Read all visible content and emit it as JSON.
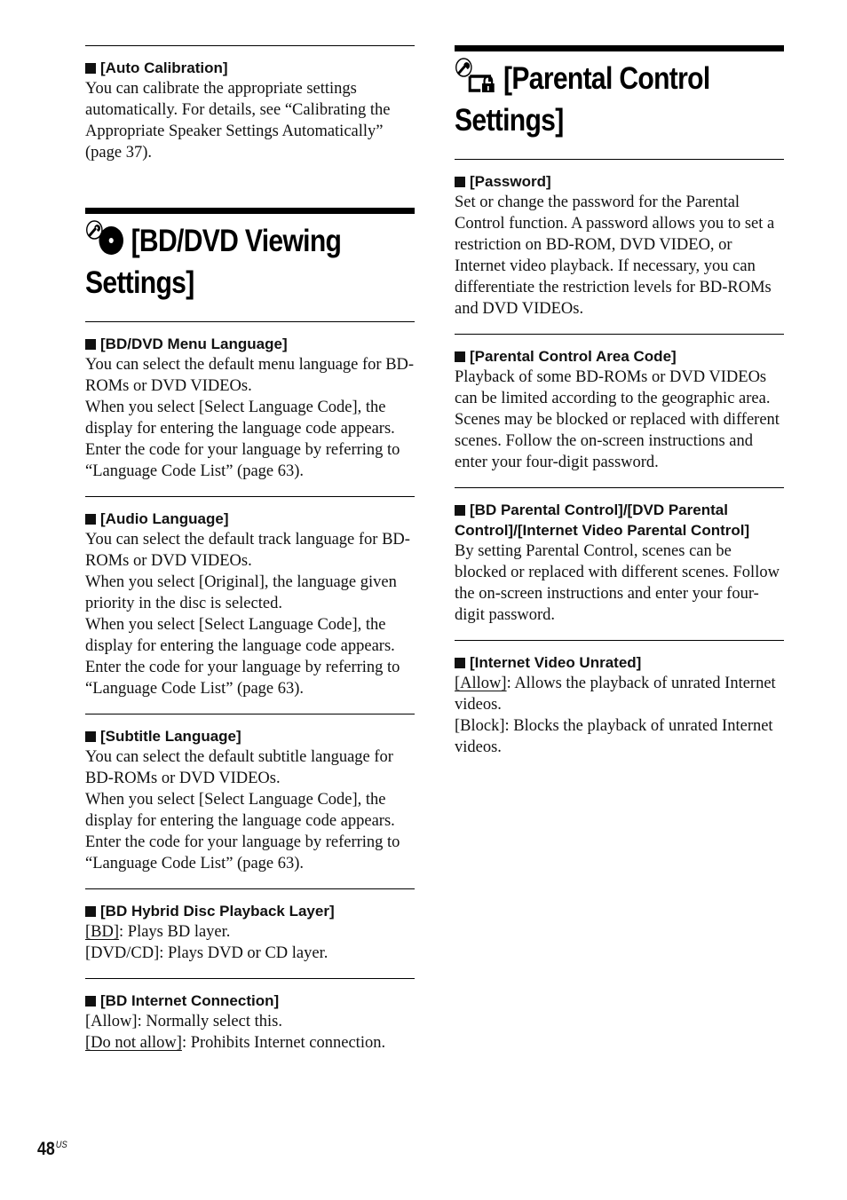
{
  "left_column": {
    "auto_calibration": {
      "heading": "[Auto Calibration]",
      "lines": [
        "You can calibrate the appropriate settings automatically. For details, see “Calibrating the Appropriate Speaker Settings Automatically” (page 37)."
      ]
    },
    "bd_dvd_chapter": {
      "icon": "wrench-disc-icon",
      "title": "[BD/DVD Viewing Settings]"
    },
    "menu_language": {
      "heading": "[BD/DVD Menu Language]",
      "lines": [
        "You can select the default menu language for BD-ROMs or DVD VIDEOs.",
        "When you select [Select Language Code], the display for entering the language code appears. Enter the code for your language by referring to “Language Code List” (page 63)."
      ]
    },
    "audio_language": {
      "heading": "[Audio Language]",
      "lines": [
        "You can select the default track language for BD-ROMs or DVD VIDEOs.",
        "When you select [Original], the language given priority in the disc is selected.",
        "When you select [Select Language Code], the display for entering the language code appears. Enter the code for your language by referring to “Language Code List” (page 63)."
      ]
    },
    "subtitle_language": {
      "heading": "[Subtitle Language]",
      "lines": [
        "You can select the default subtitle language for BD-ROMs or DVD VIDEOs.",
        "When you select [Select Language Code], the display for entering the language code appears. Enter the code for your language by referring to “Language Code List” (page 63)."
      ]
    },
    "hybrid_disc": {
      "heading": "[BD Hybrid Disc Playback Layer]",
      "options": [
        {
          "label": "[BD]",
          "default": true,
          "desc": ": Plays BD layer."
        },
        {
          "label": "[DVD/CD]",
          "default": false,
          "desc": ": Plays DVD or CD layer."
        }
      ]
    },
    "internet_connection": {
      "heading": "[BD Internet Connection]",
      "options": [
        {
          "label": "[Allow]",
          "default": false,
          "desc": ": Normally select this."
        },
        {
          "label": "[Do not allow]",
          "default": true,
          "desc": ": Prohibits Internet connection."
        }
      ]
    }
  },
  "right_column": {
    "parental_chapter": {
      "icon": "wrench-lock-icon",
      "title": "[Parental Control Settings]"
    },
    "password": {
      "heading": "[Password]",
      "lines": [
        "Set or change the password for the Parental Control function. A password allows you to set a restriction on BD-ROM, DVD VIDEO, or Internet video playback. If necessary, you can differentiate the restriction levels for BD-ROMs and DVD VIDEOs."
      ]
    },
    "area_code": {
      "heading": "[Parental Control Area Code]",
      "lines": [
        "Playback of some BD-ROMs or DVD VIDEOs can be limited according to the geographic area. Scenes may be blocked or replaced with different scenes. Follow the on-screen instructions and enter your four-digit password."
      ]
    },
    "parental_controls": {
      "heading": "[BD Parental Control]/[DVD Parental Control]/[Internet Video Parental Control]",
      "lines": [
        "By setting Parental Control, scenes can be blocked or replaced with different scenes. Follow the on-screen instructions and enter your four-digit password."
      ]
    },
    "video_unrated": {
      "heading": "[Internet Video Unrated]",
      "options": [
        {
          "label": "[Allow]",
          "default": true,
          "desc": ": Allows the playback of unrated Internet videos."
        },
        {
          "label": "[Block]",
          "default": false,
          "desc": ": Blocks the playback of unrated Internet videos."
        }
      ]
    }
  },
  "footer": {
    "page_number": "48",
    "region_suffix": "US"
  }
}
